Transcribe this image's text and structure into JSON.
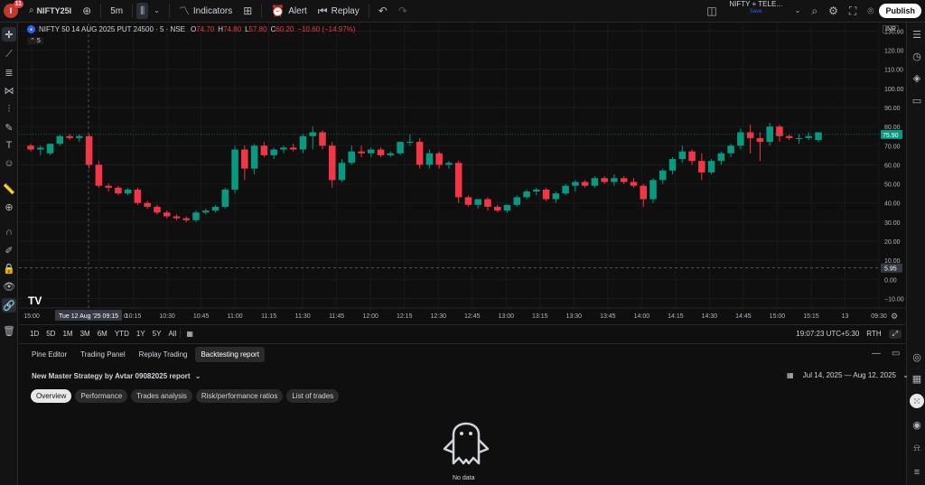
{
  "topbar": {
    "avatar_letter": "I",
    "avatar_badge": "11",
    "symbol": "NIFTY25I",
    "interval": "5m",
    "indicators_label": "Indicators",
    "alert_label": "Alert",
    "replay_label": "Replay",
    "symbol_right": "NIFTY + TELE...",
    "symbol_right_sub": "Save",
    "publish_label": "Publish"
  },
  "chart": {
    "legend_title": "NIFTY 50 14 AUG 2025 PUT 24500 · 5 · NSE",
    "ohlc": {
      "o_label": "O",
      "o": "74.70",
      "h_label": "H",
      "h": "74.80",
      "l_label": "L",
      "l": "57.80",
      "c_label": "C",
      "c": "60.20",
      "chg": "−10.60 (−14.97%)"
    },
    "legend_sub": "5",
    "currency": "INR",
    "tv_logo": "TV",
    "crosshair_date": "Tue 12 Aug '25",
    "crosshair_time": "09:15",
    "last_price": "75.90",
    "crosshair_price": "5.95",
    "colors": {
      "up": "#089981",
      "down": "#f23645"
    }
  },
  "chart_data": {
    "type": "candlestick",
    "y_ticks": [
      "130.00",
      "120.00",
      "110.00",
      "100.00",
      "90.00",
      "80.00",
      "70.00",
      "60.00",
      "50.00",
      "40.00",
      "30.00",
      "20.00",
      "10.00",
      "0.00",
      "−10.00"
    ],
    "x_ticks": [
      "15:00",
      "09:45",
      "10:00",
      "10:15",
      "10:30",
      "10:45",
      "11:00",
      "11:15",
      "11:30",
      "11:45",
      "12:00",
      "12:15",
      "12:30",
      "12:45",
      "13:00",
      "13:15",
      "13:30",
      "13:45",
      "14:00",
      "14:15",
      "14:30",
      "14:45",
      "15:00",
      "15:15",
      "13",
      "09:30"
    ],
    "x_tick_prefix": "0",
    "ylim": [
      -15,
      134
    ],
    "candles": [
      [
        70,
        71,
        67,
        68
      ],
      [
        68,
        70,
        65,
        69
      ],
      [
        66,
        71,
        65,
        71
      ],
      [
        71,
        76,
        70,
        75
      ],
      [
        75,
        76,
        73,
        74
      ],
      [
        74,
        76,
        72,
        75
      ],
      [
        75,
        76,
        58,
        60
      ],
      [
        60,
        62,
        48,
        49
      ],
      [
        49,
        50,
        46,
        48
      ],
      [
        48,
        49,
        44,
        45
      ],
      [
        45,
        48,
        44,
        47
      ],
      [
        47,
        48,
        39,
        40
      ],
      [
        40,
        41,
        37,
        38
      ],
      [
        38,
        39,
        34,
        35
      ],
      [
        35,
        36,
        32,
        33
      ],
      [
        33,
        34,
        31,
        32
      ],
      [
        32,
        33,
        30,
        31
      ],
      [
        31,
        36,
        30,
        35
      ],
      [
        35,
        37,
        34,
        36
      ],
      [
        36,
        39,
        35,
        38
      ],
      [
        38,
        48,
        37,
        47
      ],
      [
        47,
        70,
        45,
        68
      ],
      [
        68,
        70,
        52,
        58
      ],
      [
        58,
        71,
        55,
        70
      ],
      [
        70,
        72,
        64,
        65
      ],
      [
        65,
        69,
        63,
        68
      ],
      [
        68,
        70,
        66,
        69
      ],
      [
        69,
        71,
        67,
        68
      ],
      [
        68,
        76,
        66,
        75
      ],
      [
        75,
        80,
        68,
        77
      ],
      [
        77,
        78,
        68,
        70
      ],
      [
        70,
        72,
        48,
        52
      ],
      [
        52,
        63,
        51,
        61
      ],
      [
        61,
        70,
        60,
        67
      ],
      [
        67,
        70,
        64,
        66
      ],
      [
        66,
        69,
        64,
        68
      ],
      [
        68,
        69,
        64,
        65
      ],
      [
        65,
        67,
        64,
        66
      ],
      [
        66,
        71,
        65,
        72
      ],
      [
        72,
        76,
        70,
        72
      ],
      [
        72,
        74,
        58,
        60
      ],
      [
        60,
        68,
        58,
        66
      ],
      [
        66,
        67,
        58,
        60
      ],
      [
        60,
        62,
        58,
        61
      ],
      [
        61,
        62,
        40,
        43
      ],
      [
        43,
        44,
        38,
        39
      ],
      [
        39,
        42,
        37,
        42
      ],
      [
        42,
        43,
        36,
        38
      ],
      [
        38,
        39,
        35,
        36
      ],
      [
        36,
        39,
        35,
        39
      ],
      [
        39,
        44,
        38,
        43
      ],
      [
        43,
        47,
        42,
        46
      ],
      [
        46,
        48,
        44,
        47
      ],
      [
        47,
        48,
        41,
        42
      ],
      [
        42,
        46,
        40,
        45
      ],
      [
        45,
        50,
        44,
        49
      ],
      [
        49,
        52,
        46,
        51
      ],
      [
        51,
        52,
        48,
        49
      ],
      [
        49,
        54,
        48,
        53
      ],
      [
        53,
        54,
        50,
        51
      ],
      [
        51,
        55,
        49,
        53
      ],
      [
        53,
        54,
        50,
        51
      ],
      [
        51,
        53,
        48,
        49
      ],
      [
        49,
        50,
        38,
        42
      ],
      [
        42,
        53,
        40,
        52
      ],
      [
        52,
        58,
        50,
        57
      ],
      [
        57,
        64,
        55,
        63
      ],
      [
        63,
        70,
        61,
        67
      ],
      [
        67,
        68,
        60,
        62
      ],
      [
        62,
        66,
        52,
        56
      ],
      [
        56,
        63,
        55,
        62
      ],
      [
        62,
        67,
        60,
        66
      ],
      [
        66,
        71,
        64,
        70
      ],
      [
        70,
        79,
        68,
        77
      ],
      [
        77,
        81,
        66,
        74
      ],
      [
        74,
        77,
        62,
        72
      ],
      [
        72,
        82,
        70,
        80
      ],
      [
        80,
        81,
        72,
        75
      ],
      [
        75,
        76,
        73,
        74
      ],
      [
        74,
        76,
        71,
        74
      ],
      [
        74,
        77,
        73,
        75
      ],
      [
        73,
        77,
        72,
        77
      ]
    ]
  },
  "rangebar": {
    "ranges": [
      "1D",
      "5D",
      "1M",
      "3M",
      "6M",
      "YTD",
      "1Y",
      "5Y",
      "All"
    ],
    "clock": "19:07:23 UTC+5:30",
    "adj": "RTH"
  },
  "panel": {
    "tabs": [
      "Pine Editor",
      "Trading Panel",
      "Replay Trading",
      "Backtesting report"
    ],
    "report_title": "New Master Strategy by Avtar 09082025 report",
    "date_range": "Jul 14, 2025 — Aug 12, 2025",
    "chips": [
      "Overview",
      "Performance",
      "Trades analysis",
      "Risk/performance ratios",
      "List of trades"
    ],
    "no_data": "No data"
  }
}
